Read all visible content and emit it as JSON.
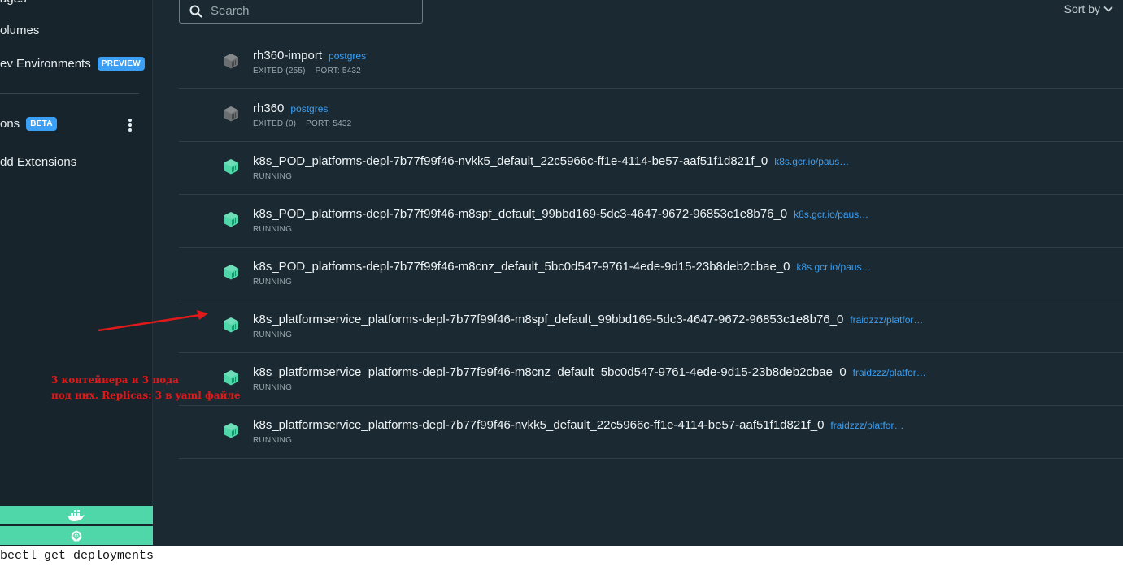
{
  "sidebar": {
    "items": [
      {
        "label": "ages"
      },
      {
        "label": "olumes"
      },
      {
        "label": "ev Environments",
        "badge": "PREVIEW"
      },
      {
        "label": "ons",
        "badge": "BETA"
      },
      {
        "label": "dd Extensions"
      }
    ]
  },
  "search": {
    "placeholder": "Search"
  },
  "sort": {
    "label": "Sort by"
  },
  "containers": [
    {
      "name": "rh360-import",
      "image": "postgres",
      "status": "EXITED (255)",
      "port": "PORT: 5432"
    },
    {
      "name": "rh360",
      "image": "postgres",
      "status": "EXITED (0)",
      "port": "PORT: 5432"
    },
    {
      "name": "k8s_POD_platforms-depl-7b77f99f46-nvkk5_default_22c5966c-ff1e-4114-be57-aaf51f1d821f_0",
      "image": "k8s.gcr.io/paus…",
      "status": "RUNNING"
    },
    {
      "name": "k8s_POD_platforms-depl-7b77f99f46-m8spf_default_99bbd169-5dc3-4647-9672-96853c1e8b76_0",
      "image": "k8s.gcr.io/paus…",
      "status": "RUNNING"
    },
    {
      "name": "k8s_POD_platforms-depl-7b77f99f46-m8cnz_default_5bc0d547-9761-4ede-9d15-23b8deb2cbae_0",
      "image": "k8s.gcr.io/paus…",
      "status": "RUNNING"
    },
    {
      "name": "k8s_platformservice_platforms-depl-7b77f99f46-m8spf_default_99bbd169-5dc3-4647-9672-96853c1e8b76_0",
      "image": "fraidzzz/platfor…",
      "status": "RUNNING"
    },
    {
      "name": "k8s_platformservice_platforms-depl-7b77f99f46-m8cnz_default_5bc0d547-9761-4ede-9d15-23b8deb2cbae_0",
      "image": "fraidzzz/platfor…",
      "status": "RUNNING"
    },
    {
      "name": "k8s_platformservice_platforms-depl-7b77f99f46-nvkk5_default_22c5966c-ff1e-4114-be57-aaf51f1d821f_0",
      "image": "fraidzzz/platfor…",
      "status": "RUNNING"
    }
  ],
  "annotation": {
    "line1": "3 контейнера и 3 пода",
    "line2": "под них. Replicas: 3 в yaml файле"
  },
  "terminal": {
    "text": "bectl get deployments"
  },
  "colors": {
    "running": "#4fd6a9",
    "exited": "#6b6f72",
    "link": "#3a9ff5",
    "annotation": "#e01a1a"
  },
  "icons": {
    "search": "search-icon",
    "sort": "chevron-down-icon",
    "container": "container-icon",
    "whale": "docker-whale-icon",
    "kube": "kubernetes-icon"
  }
}
